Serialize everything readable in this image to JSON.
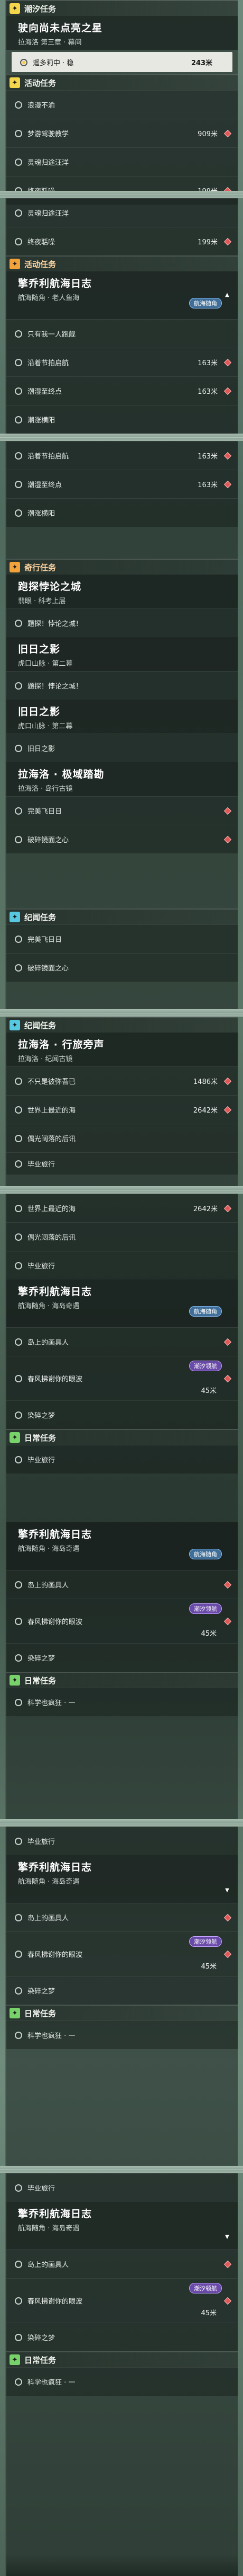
{
  "headers": {
    "tide": "潮汐任务",
    "event": "活动任务",
    "adventure": "奇行任务",
    "legend": "纪闻任务",
    "daily": "日常任务"
  },
  "t_dazzle": {
    "title": "驶向尚未点亮之星",
    "sub": "拉海洛 第三章 · 幕间"
  },
  "c_far_journey": "遥多莉中 · 稳",
  "d_far_journey": "243米",
  "c_slow_wave": "浪漫不渝",
  "c_dream_travel": "梦游驾驶教学",
  "c_unfinished_dream": "未竟的梦",
  "c_sea_shore": "灵魂归途汪洋",
  "c_endless_river": "终夜聒噪",
  "d_909": "909米",
  "d_199": "199米",
  "t_pilot": {
    "title": "擎乔利航海日志",
    "sub": "航海随角 · 老人鱼海"
  },
  "pill_sea": "航海随角",
  "pill_tide": "潮汐领航",
  "c_only_one": "只有我一人跑舰",
  "c_along_port": "沿着节拍启航",
  "c_tide_ring": "潮湿至终点",
  "c_tide_listen": "潮涨横阳",
  "d_163": "163米",
  "t_paradox": {
    "title": "跑探悖论之城",
    "sub": "翡眼 · 科考上层"
  },
  "c_quest_start": "题探！悖论之城！",
  "t_sunset": {
    "title": "旧日之影",
    "sub": "虎口山脉 · 第二幕"
  },
  "c_sunset": "旧日之影",
  "t_lahai": {
    "title": "拉海洛 · 极域踏勘",
    "sub": "拉海洛 · 岛行古镜"
  },
  "c_wanmei": "完美飞日日",
  "c_mirror_heart": "破碎镜面之心",
  "t_aria": {
    "title": "拉海洛 · 行旅旁声",
    "sub": "拉海洛 · 纪闻古镜"
  },
  "c_never_forget": "不只是彼弥吾已",
  "c_world_sea": "世界上最近的海",
  "c_cloud_sea": "偶光阔落的后讯",
  "c_graduate": "毕业旅行",
  "d_1486": "1486米",
  "d_2642": "2642米",
  "t_maze": {
    "title": "擎乔利航海日志",
    "sub": "航海随角 · 海岛奇遇"
  },
  "c_island_people": "岛上的画具人",
  "c_spring_flower": "春风拂谢你的眼波",
  "c_dye_dream": "染碎之梦",
  "c_science": "科学也疯狂 · 一",
  "d_45": "45米"
}
